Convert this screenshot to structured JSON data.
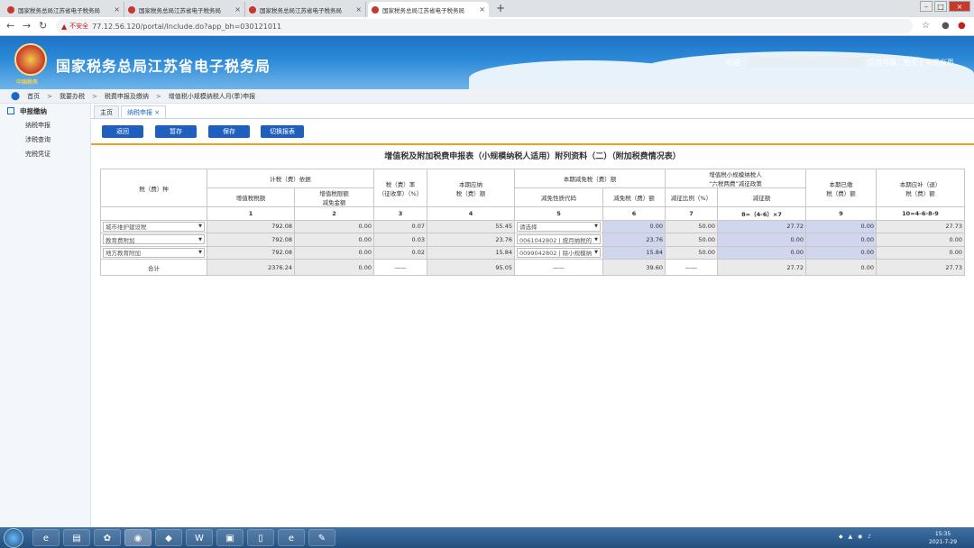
{
  "browser": {
    "tabs": [
      {
        "title": "国家税务总局江苏省电子税务局",
        "active": false
      },
      {
        "title": "国家税务总局江苏省电子税务局",
        "active": false
      },
      {
        "title": "国家税务总局江苏省电子税务局",
        "active": false
      },
      {
        "title": "国家税务总局江苏省电子税务局",
        "active": true
      }
    ],
    "insecure_label": "不安全",
    "url": "77.12.56.120/portal/Include.do?app_bh=030121011"
  },
  "header": {
    "site_title": "国家税务总局江苏省电子税务局",
    "logo_subtitle": "中国税务",
    "welcome_prefix": "欢迎",
    "user_info": "信用等级：暂无 | 关闭当页"
  },
  "breadcrumb": [
    "首页",
    "我要办税",
    "税费申报及缴纳",
    "增值税小规模纳税人月(季)申报"
  ],
  "sidebar": {
    "header": "申报缴纳",
    "items": [
      "纳税申报",
      "涉税查询",
      "完税凭证"
    ]
  },
  "page_tabs": [
    {
      "label": "主页"
    },
    {
      "label": "纳税申报 ×"
    }
  ],
  "toolbar": {
    "back": "返回",
    "save_draft": "暂存",
    "save": "保存",
    "switch": "切换报表"
  },
  "form": {
    "title": "增值税及附加税费申报表（小规模纳税人适用）附列资料（二）（附加税费情况表）",
    "headers": {
      "tax_type": "税（费）种",
      "basis_group": "计税（费）依据",
      "vat_amount": "增值税税额",
      "vat_reduction": "增值税限额",
      "vat_reduction2": "减免金额",
      "rate": "税（费）率",
      "rate2": "（征收率）（%）",
      "current_payable": "本期应纳",
      "current_payable2": "税（费）额",
      "relief_group": "本期减免税（费）额",
      "relief_code": "减免性质代码",
      "relief_amount": "减免税（费）额",
      "small_group": "增值税小规模纳税人",
      "small_group2": "“六税两费”减征政策",
      "reduce_ratio": "减征比例（%）",
      "reduce_amount": "减征额",
      "paid": "本期已缴",
      "paid2": "税（费）额",
      "refund": "本期应补（退）",
      "refund2": "税（费）额"
    },
    "col_numbers": [
      "1",
      "2",
      "3",
      "4",
      "5",
      "6",
      "7",
      "8=（4-6）×7",
      "9",
      "10=4-6-8-9"
    ],
    "rows": [
      {
        "name": "城市维护建设税",
        "c1": "792.08",
        "c2": "0.00",
        "c3": "0.07",
        "c4": "55.45",
        "c5": "请选择",
        "c6": "0.00",
        "c7": "50.00",
        "c8": "27.72",
        "c9": "0.00",
        "c10": "27.73"
      },
      {
        "name": "教育费附加",
        "c1": "792.08",
        "c2": "0.00",
        "c3": "0.03",
        "c4": "23.76",
        "c5": "0061042802 | 按月纳税的",
        "c6": "23.76",
        "c7": "50.00",
        "c8": "0.00",
        "c9": "0.00",
        "c10": "0.00"
      },
      {
        "name": "地方教育附加",
        "c1": "792.08",
        "c2": "0.00",
        "c3": "0.02",
        "c4": "15.84",
        "c5": "0099042802 | 除小规模纳",
        "c6": "15.84",
        "c7": "50.00",
        "c8": "0.00",
        "c9": "0.00",
        "c10": "0.00"
      }
    ],
    "total": {
      "name": "合计",
      "c1": "2376.24",
      "c2": "0.00",
      "c3": "——",
      "c4": "95.05",
      "c5": "——",
      "c6": "39.60",
      "c7": "——",
      "c8": "27.72",
      "c9": "0.00",
      "c10": "27.73"
    }
  },
  "taskbar": {
    "time": "15:35",
    "date": "2021-7-29"
  }
}
